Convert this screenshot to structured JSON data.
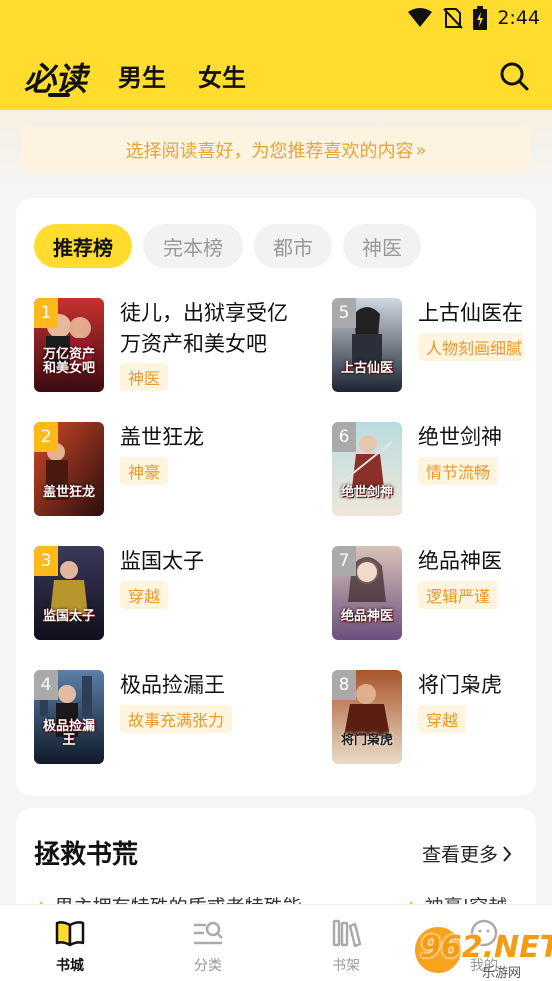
{
  "status_bar": {
    "time": "2:44"
  },
  "header": {
    "logo": "必读",
    "tabs": [
      {
        "label": "男生"
      },
      {
        "label": "女生"
      }
    ]
  },
  "banner": {
    "text": "选择阅读喜好，为您推荐喜欢的内容",
    "arrow": "»"
  },
  "ranking": {
    "chips": [
      {
        "label": "推荐榜",
        "active": true
      },
      {
        "label": "完本榜",
        "active": false
      },
      {
        "label": "都市",
        "active": false
      },
      {
        "label": "神医",
        "active": false
      }
    ],
    "books": [
      {
        "rank": "1",
        "title": "徒儿，出狱享受亿万资产和美女吧",
        "tag": "神医",
        "cover_text": "万亿资产和美女吧"
      },
      {
        "rank": "5",
        "title": "上古仙医在",
        "tag": "人物刻画细腻",
        "cover_text": "上古仙医"
      },
      {
        "rank": "2",
        "title": "盖世狂龙",
        "tag": "神豪",
        "cover_text": "盖世狂龙"
      },
      {
        "rank": "6",
        "title": "绝世剑神",
        "tag": "情节流畅",
        "cover_text": "绝世剑神"
      },
      {
        "rank": "3",
        "title": "监国太子",
        "tag": "穿越",
        "cover_text": "监国太子"
      },
      {
        "rank": "7",
        "title": "绝品神医",
        "tag": "逻辑严谨",
        "cover_text": "绝品神医"
      },
      {
        "rank": "4",
        "title": "极品捡漏王",
        "tag": "故事充满张力",
        "cover_text": "极品捡漏王"
      },
      {
        "rank": "8",
        "title": "将门枭虎",
        "tag": "穿越",
        "cover_text": "将门枭虎"
      }
    ]
  },
  "rescue": {
    "title": "拯救书荒",
    "see_more": "查看更多",
    "peek_left": "男主拥有特殊的质或者特殊能",
    "peek_right": "神豪|穿越"
  },
  "bottom_nav": [
    {
      "label": "书城",
      "icon": "book-open-icon",
      "active": true
    },
    {
      "label": "分类",
      "icon": "category-search-icon",
      "active": false
    },
    {
      "label": "书架",
      "icon": "bookshelf-icon",
      "active": false
    },
    {
      "label": "我的",
      "icon": "profile-icon",
      "active": false
    }
  ],
  "watermark": {
    "big": "962.NET",
    "small": "乐游网"
  },
  "colors": {
    "accent": "#ffdc2e",
    "tag_text": "#e69a2e",
    "tag_bg": "#fff4de",
    "rank_top": "#ffb91a"
  }
}
